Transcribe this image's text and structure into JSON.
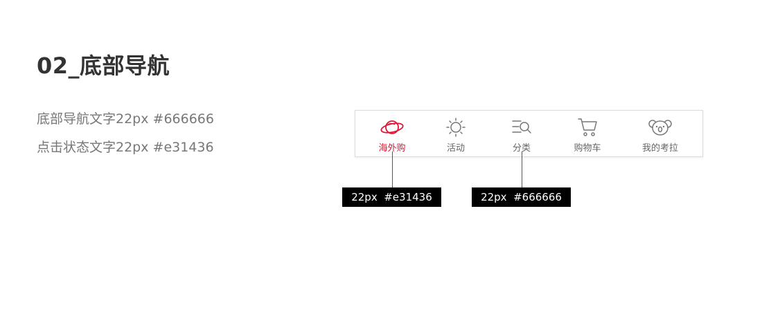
{
  "page": {
    "title": "02_底部导航",
    "notes": [
      "底部导航文字22px #666666",
      "点击状态文字22px #e31436"
    ]
  },
  "bottom_nav": {
    "items": [
      {
        "label": "海外购",
        "icon": "planet-icon",
        "active": true
      },
      {
        "label": "活动",
        "icon": "sun-icon",
        "active": false
      },
      {
        "label": "分类",
        "icon": "category-search-icon",
        "active": false
      },
      {
        "label": "购物车",
        "icon": "cart-icon",
        "active": false
      },
      {
        "label": "我的考拉",
        "icon": "koala-icon",
        "active": false
      }
    ],
    "active_color": "#e31436",
    "inactive_color": "#666666"
  },
  "annotations": [
    {
      "text": "22px  #e31436"
    },
    {
      "text": "22px  #666666"
    }
  ]
}
